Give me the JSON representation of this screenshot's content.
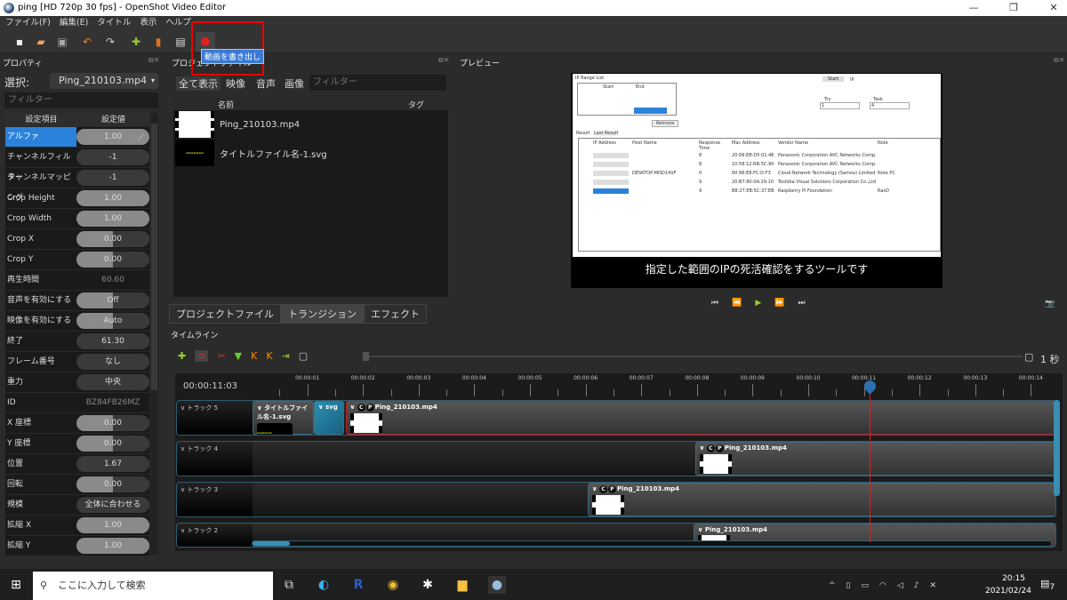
{
  "window": {
    "title": "ping [HD 720p 30 fps] - OpenShot Video Editor",
    "minimize": "—",
    "maximize": "❐",
    "close": "✕"
  },
  "menu": [
    "ファイル(F)",
    "編集(E)",
    "タイトル",
    "表示",
    "ヘルプ"
  ],
  "toolbar": {
    "tooltip": "動画を書き出し",
    "icons": [
      "new-project-icon",
      "open-project-icon",
      "save-project-icon",
      "undo-icon",
      "redo-icon",
      "import-files-icon",
      "choose-profile-icon",
      "fullscreen-icon",
      "export-video-icon"
    ],
    "highlight_color": "#ff0000"
  },
  "properties": {
    "title": "プロパティ",
    "select_label": "選択:",
    "selected": "Ping_210103.mp4",
    "filter_placeholder": "フィルター",
    "col_key": "設定項目",
    "col_value": "設定値",
    "rows": [
      {
        "key": "アルファ",
        "value": "1.00",
        "fill": 1.0
      },
      {
        "key": "チャンネルフィルター",
        "value": "-1",
        "fill": 0
      },
      {
        "key": "チャンネルマッピング",
        "value": "-1",
        "fill": 0
      },
      {
        "key": "Crop Height",
        "value": "1.00",
        "fill": 1.0
      },
      {
        "key": "Crop Width",
        "value": "1.00",
        "fill": 1.0
      },
      {
        "key": "Crop X",
        "value": "0.00",
        "fill": 0.5
      },
      {
        "key": "Crop Y",
        "value": "0.00",
        "fill": 0.5
      },
      {
        "key": "再生時間",
        "value": "60.60",
        "readonly": true
      },
      {
        "key": "音声を有効にする",
        "value": "Off",
        "fill": 0.5
      },
      {
        "key": "映像を有効にする",
        "value": "Auto",
        "fill": 0.5
      },
      {
        "key": "終了",
        "value": "61.30",
        "fill": 0
      },
      {
        "key": "フレーム番号",
        "value": "なし",
        "fill": 0
      },
      {
        "key": "重力",
        "value": "中央",
        "fill": 0
      },
      {
        "key": "ID",
        "value": "BZ84FB26MZ",
        "readonly": true
      },
      {
        "key": "X 座標",
        "value": "0.00",
        "fill": 0.5
      },
      {
        "key": "Y 座標",
        "value": "0.00",
        "fill": 0.5
      },
      {
        "key": "位置",
        "value": "1.67",
        "fill": 0
      },
      {
        "key": "回転",
        "value": "0.00",
        "fill": 0.5
      },
      {
        "key": "規模",
        "value": "全体に合わせる",
        "fill": 0
      },
      {
        "key": "拡縮 X",
        "value": "1.00",
        "fill": 1.0
      },
      {
        "key": "拡縮 Y",
        "value": "1.00",
        "fill": 1.0
      }
    ]
  },
  "project_files": {
    "title": "プロジェクトファイル",
    "tabs": [
      "全て表示",
      "映像",
      "音声",
      "画像"
    ],
    "filter_placeholder": "フィルター",
    "col_name": "名前",
    "col_tag": "タグ",
    "files": [
      {
        "name": "Ping_210103.mp4"
      },
      {
        "name": "タイトルファイル名-1.svg"
      }
    ],
    "bottom_tabs": [
      "プロジェクトファイル",
      "トランジション",
      "エフェクト"
    ]
  },
  "preview": {
    "title": "プレビュー",
    "subtitle": "指定した範囲のIPの死活確認をするツールです",
    "app": {
      "range_title": "IP Range List",
      "range_cols": [
        "Start",
        "End"
      ],
      "start_btn": "Start",
      "ip_label": "IP",
      "try_label": "Try",
      "try_value": "1",
      "task_label": "Task",
      "task_value": "4",
      "remove_btn": "Remove",
      "tabs": [
        "Result",
        "Last Result"
      ],
      "cols": [
        "IP Address",
        "Host Name",
        "Response Time",
        "Mac Address",
        "Vendor Name",
        "Note"
      ],
      "rows": [
        [
          "",
          "",
          "8",
          "20:06:EB:D5:01:46",
          "Panasonic Corporation AVC Networks Comp.",
          ""
        ],
        [
          "",
          "",
          "8",
          "10:58:12:RB:5C:90",
          "Panasonic Corporation AVC Networks Comp.",
          ""
        ],
        [
          "",
          "DESKTOP-MOD14VF",
          "0",
          "00:96:E8:FC:D:F3",
          "Cloud Network Technology (Samoa) Limited",
          "Note PC"
        ],
        [
          "",
          "",
          "9",
          "20:B7:80:0A:29:10",
          "Toshiba Visual Solutions Corporation Co.,Ltd",
          ""
        ],
        [
          "",
          "",
          "9",
          "B8:27:EB:5C:37:EB",
          "Raspberry Pi Foundation",
          "RasO"
        ]
      ]
    }
  },
  "timeline": {
    "title": "タイムライン",
    "current_time": "00:00:11:03",
    "zoom_label": "1 秒",
    "ruler": [
      "00:00:01",
      "00:00:02",
      "00:00:03",
      "00:00:04",
      "00:00:05",
      "00:00:06",
      "00:00:07",
      "00:00:08",
      "00:00:09",
      "00:00:10",
      "00:00:11",
      "00:00:12",
      "00:00:13",
      "00:00:14"
    ],
    "playhead_seconds": 11.1,
    "tracks": [
      {
        "name": "トラック 5",
        "clips": [
          {
            "label": "タイトルファイル名-1.svg",
            "start": 0,
            "end": 1.1,
            "title": true
          },
          {
            "label": "svg",
            "start": 1.1,
            "end": 1.65,
            "transition": true
          },
          {
            "label": "Ping_210103.mp4",
            "start": 1.67,
            "end": 14.5,
            "cp": true
          }
        ]
      },
      {
        "name": "トラック 4",
        "clips": [
          {
            "label": "Ping_210103.mp4",
            "start": 7.95,
            "end": 14.5,
            "cp": true
          }
        ]
      },
      {
        "name": "トラック 3",
        "clips": [
          {
            "label": "Ping_210103.mp4",
            "start": 6.02,
            "end": 14.5,
            "cp": true
          }
        ]
      },
      {
        "name": "トラック 2",
        "clips": [
          {
            "label": "Ping_210103.mp4",
            "start": 7.92,
            "end": 14.5
          }
        ]
      }
    ]
  },
  "taskbar": {
    "search_placeholder": "ここに入力して検索",
    "time": "20:15",
    "date": "2021/02/24",
    "notifications": "7"
  }
}
